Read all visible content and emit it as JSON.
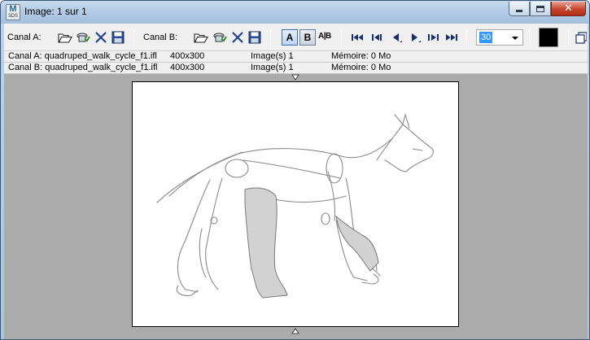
{
  "window": {
    "title": "Image: 1 sur 1",
    "app_icon_letter": "M",
    "app_icon_sub": "3DS"
  },
  "toolbar": {
    "channel_a_label": "Canal A:",
    "channel_b_label": "Canal B:",
    "a_button": "A",
    "b_button": "B",
    "ab_split_label": "A|B",
    "frame_value": "30",
    "color_swatch": "#000000"
  },
  "info": {
    "rows": [
      {
        "name": "Canal A: quadruped_walk_cycle_f1.ifl",
        "size": "400x300",
        "images": "Image(s) 1",
        "memory": "Mémoire: 0 Mo"
      },
      {
        "name": "Canal B: quadruped_walk_cycle_f1.ifl",
        "size": "400x300",
        "images": "Image(s) 1",
        "memory": "Mémoire: 0 Mo"
      }
    ]
  },
  "colors": {
    "client_bg": "#ababab",
    "selection": "#3399ff",
    "toolbar_bg": "#f0f0f0"
  },
  "icons": [
    "open-folder-icon",
    "view-icon",
    "clear-icon",
    "save-icon",
    "first-frame-icon",
    "previous-frame-icon",
    "play-reverse-icon",
    "play-icon",
    "next-frame-icon",
    "last-frame-icon"
  ]
}
